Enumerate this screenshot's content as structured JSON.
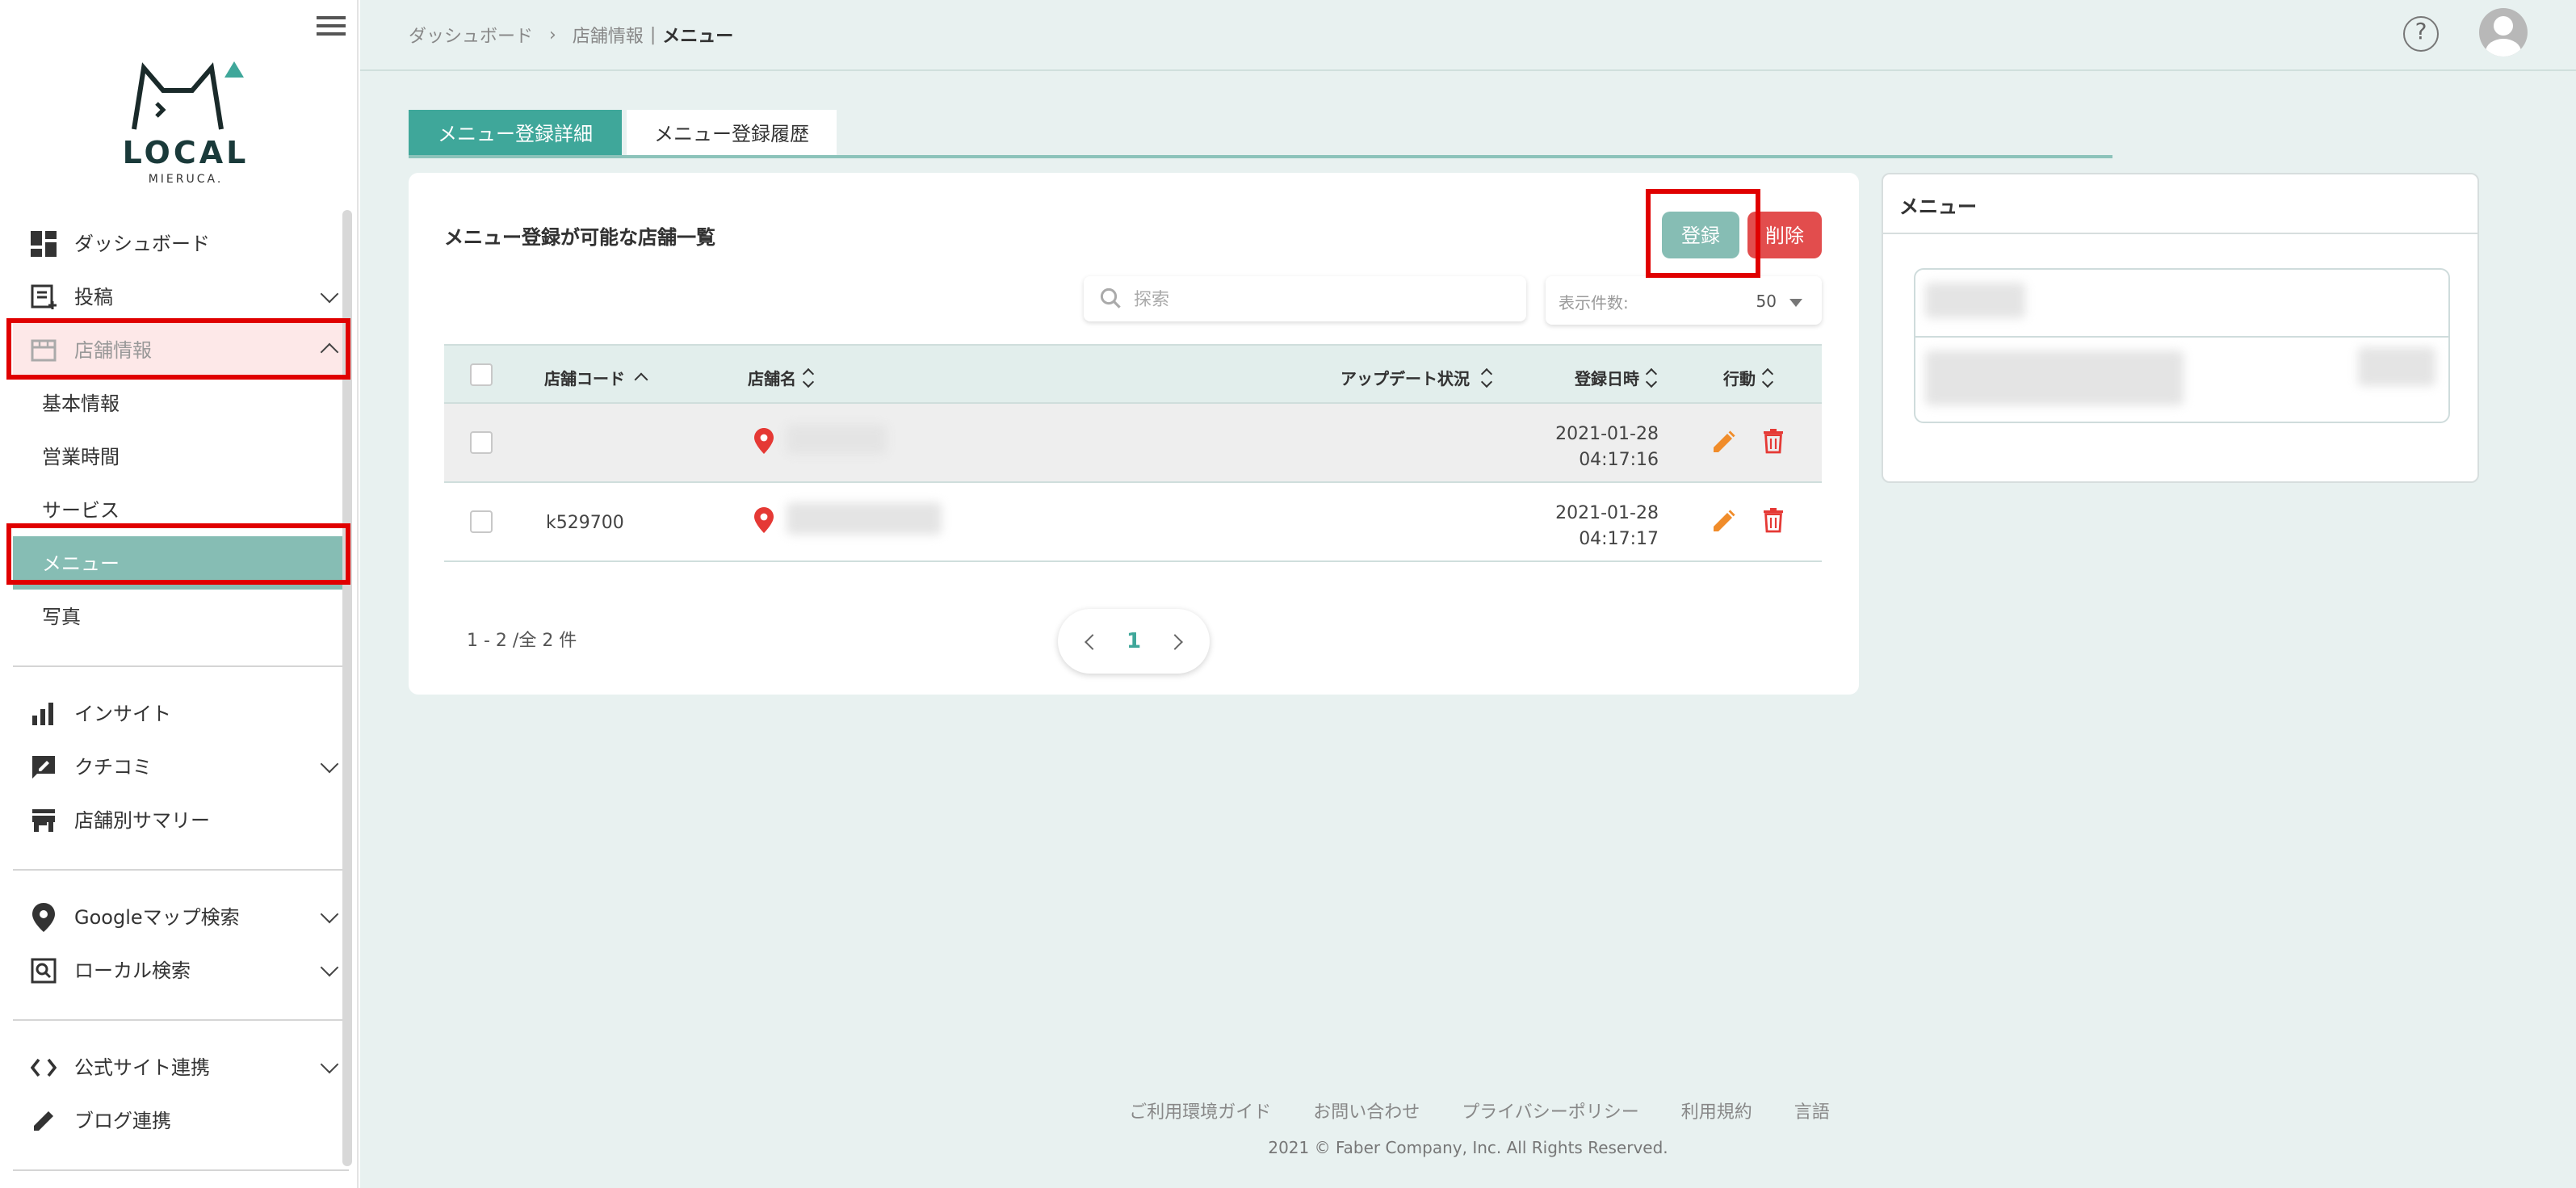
{
  "brand": {
    "name": "LOCAL",
    "sub": "MIERUCA."
  },
  "sidebar": {
    "items": [
      {
        "label": "ダッシュボード"
      },
      {
        "label": "投稿"
      },
      {
        "label": "店舗情報"
      },
      {
        "label": "基本情報"
      },
      {
        "label": "営業時間"
      },
      {
        "label": "サービス"
      },
      {
        "label": "メニュー"
      },
      {
        "label": "写真"
      },
      {
        "label": "インサイト"
      },
      {
        "label": "クチコミ"
      },
      {
        "label": "店舗別サマリー"
      },
      {
        "label": "Googleマップ検索"
      },
      {
        "label": "ローカル検索"
      },
      {
        "label": "公式サイト連携"
      },
      {
        "label": "ブログ連携"
      }
    ]
  },
  "breadcrumb": {
    "home": "ダッシュボード",
    "section": "店舗情報",
    "divider": "|",
    "current": "メニュー"
  },
  "header": {
    "help": "?"
  },
  "tabs": [
    {
      "label": "メニュー登録詳細"
    },
    {
      "label": "メニュー登録履歴"
    }
  ],
  "card": {
    "title": "メニュー登録が可能な店舗一覧",
    "register_label": "登録",
    "delete_label": "削除",
    "search_placeholder": "探索",
    "perpage_label": "表示件数:",
    "perpage_value": "50"
  },
  "table": {
    "headers": {
      "code": "店舗コード",
      "name": "店舗名",
      "update": "アップデート状況",
      "date": "登録日時",
      "action": "行動"
    },
    "rows": [
      {
        "code": "",
        "date": "2021-01-28",
        "time": "04:17:16"
      },
      {
        "code": "k529700",
        "date": "2021-01-28",
        "time": "04:17:17"
      }
    ]
  },
  "pagination": {
    "summary": "1 - 2 /全 2 件",
    "current": "1"
  },
  "right_panel": {
    "title": "メニュー"
  },
  "footer": {
    "links": [
      "ご利用環境ガイド",
      "お問い合わせ",
      "プライバシーポリシー",
      "利用規約",
      "言語"
    ],
    "copyright": "2021 © Faber Company, Inc. All Rights Reserved."
  },
  "colors": {
    "accent": "#3fa79a",
    "selected": "#86bdb4",
    "danger": "#e24d4d",
    "highlight": "#e00000"
  }
}
